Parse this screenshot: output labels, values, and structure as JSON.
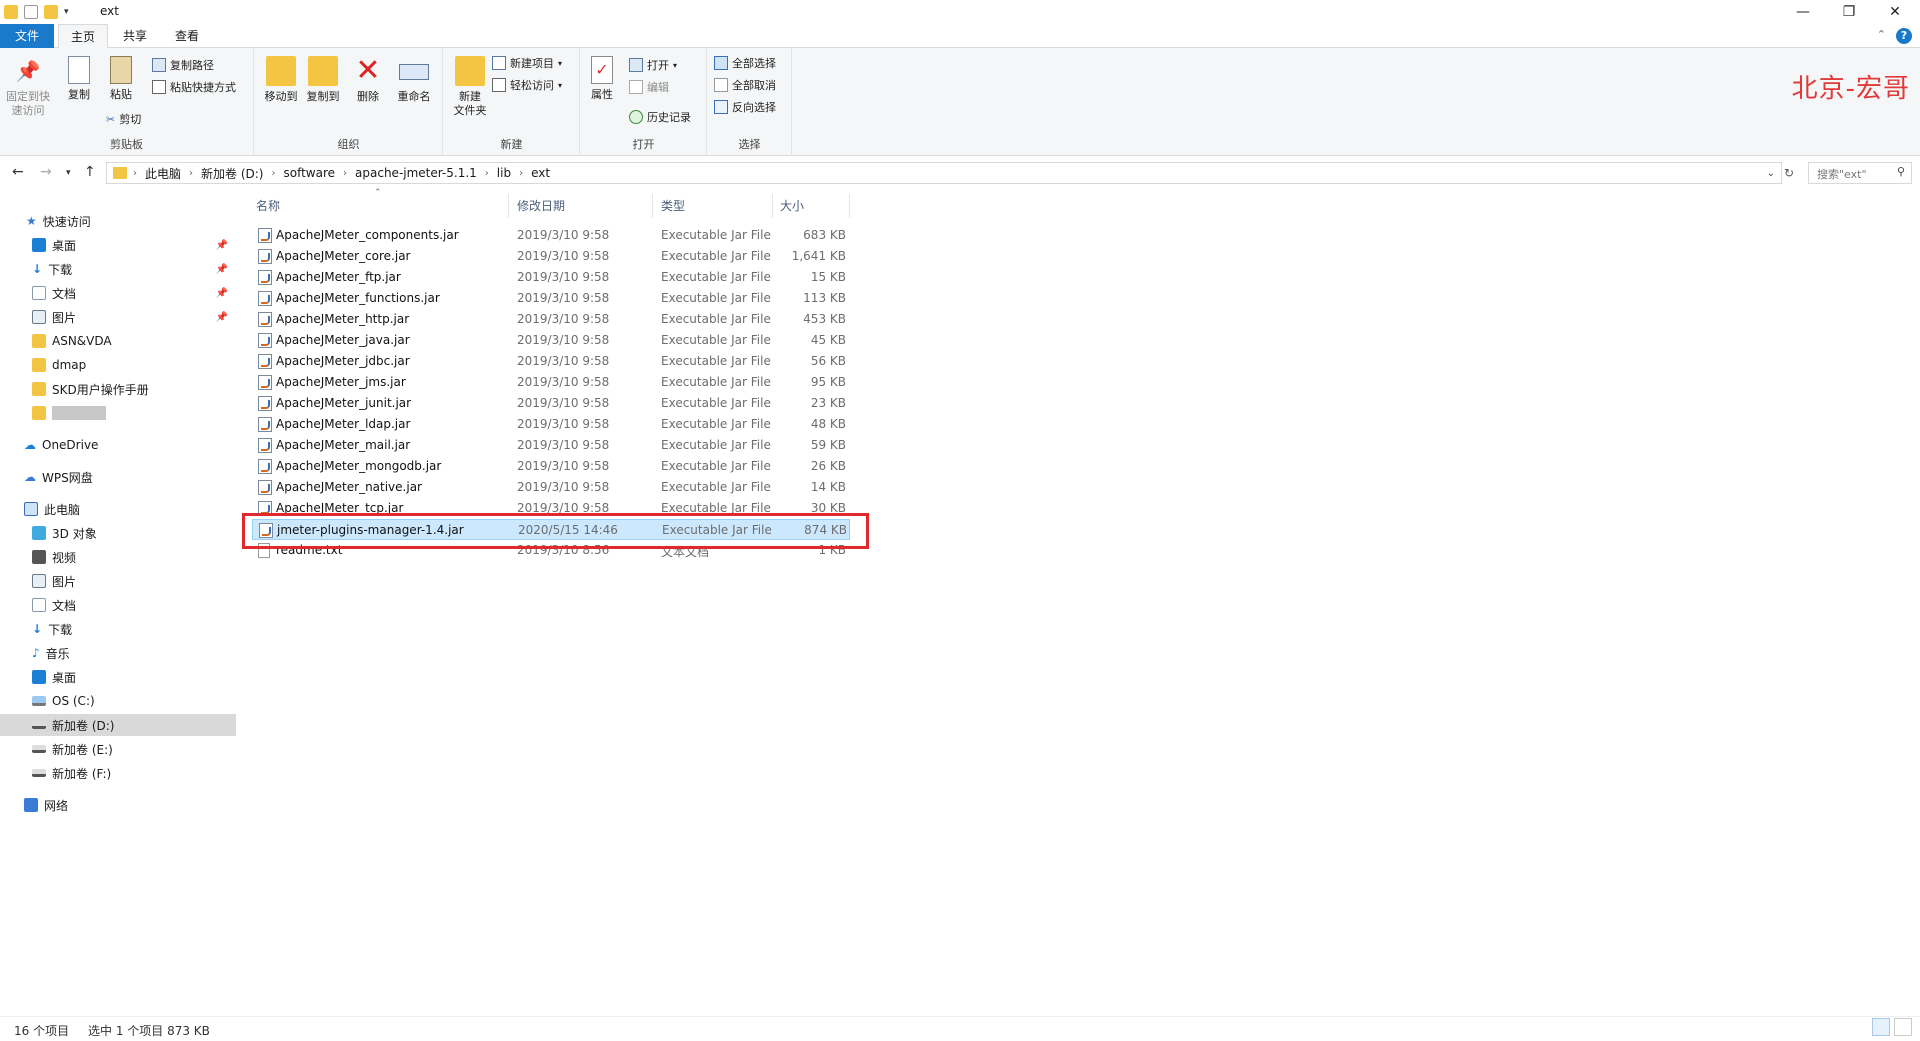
{
  "window": {
    "title": "ext",
    "controls": {
      "minimize": "—",
      "maximize": "❐",
      "close": "✕"
    }
  },
  "ribbon_tabs": [
    "文件",
    "主页",
    "共享",
    "查看"
  ],
  "ribbon": {
    "clipboard": {
      "label": "剪贴板",
      "pin": "固定到快\n速访问",
      "pin_line1": "固定到快",
      "pin_line2": "速访问",
      "copy": "复制",
      "paste": "粘贴",
      "copy_path": "复制路径",
      "paste_shortcut": "粘贴快捷方式",
      "cut": "剪切"
    },
    "organize": {
      "label": "组织",
      "move_to": "移动到",
      "copy_to": "复制到",
      "delete": "删除",
      "rename": "重命名"
    },
    "new": {
      "label": "新建",
      "new_folder_line1": "新建",
      "new_folder_line2": "文件夹",
      "new_item": "新建项目",
      "easy_access": "轻松访问"
    },
    "open": {
      "label": "打开",
      "properties": "属性",
      "open": "打开",
      "edit": "编辑",
      "history": "历史记录"
    },
    "select": {
      "label": "选择",
      "select_all": "全部选择",
      "select_none": "全部取消",
      "invert": "反向选择"
    },
    "watermark": "北京-宏哥"
  },
  "address": {
    "crumbs": [
      "此电脑",
      "新加卷 (D:)",
      "software",
      "apache-jmeter-5.1.1",
      "lib",
      "ext"
    ],
    "search_placeholder": "搜索\"ext\""
  },
  "sidebar": {
    "quick_access": "快速访问",
    "quick_items": [
      "桌面",
      "下载",
      "文档",
      "图片",
      "ASN&VDA",
      "dmap",
      "SKD用户操作手册"
    ],
    "onedrive": "OneDrive",
    "wps": "WPS网盘",
    "this_pc": "此电脑",
    "pc_items": [
      "3D 对象",
      "视频",
      "图片",
      "文档",
      "下载",
      "音乐",
      "桌面",
      "OS (C:)",
      "新加卷 (D:)",
      "新加卷 (E:)",
      "新加卷 (F:)"
    ],
    "network": "网络"
  },
  "columns": {
    "name": "名称",
    "date": "修改日期",
    "type": "类型",
    "size": "大小"
  },
  "files": [
    {
      "name": "ApacheJMeter_components.jar",
      "date": "2019/3/10 9:58",
      "type": "Executable Jar File",
      "size": "683 KB"
    },
    {
      "name": "ApacheJMeter_core.jar",
      "date": "2019/3/10 9:58",
      "type": "Executable Jar File",
      "size": "1,641 KB"
    },
    {
      "name": "ApacheJMeter_ftp.jar",
      "date": "2019/3/10 9:58",
      "type": "Executable Jar File",
      "size": "15 KB"
    },
    {
      "name": "ApacheJMeter_functions.jar",
      "date": "2019/3/10 9:58",
      "type": "Executable Jar File",
      "size": "113 KB"
    },
    {
      "name": "ApacheJMeter_http.jar",
      "date": "2019/3/10 9:58",
      "type": "Executable Jar File",
      "size": "453 KB"
    },
    {
      "name": "ApacheJMeter_java.jar",
      "date": "2019/3/10 9:58",
      "type": "Executable Jar File",
      "size": "45 KB"
    },
    {
      "name": "ApacheJMeter_jdbc.jar",
      "date": "2019/3/10 9:58",
      "type": "Executable Jar File",
      "size": "56 KB"
    },
    {
      "name": "ApacheJMeter_jms.jar",
      "date": "2019/3/10 9:58",
      "type": "Executable Jar File",
      "size": "95 KB"
    },
    {
      "name": "ApacheJMeter_junit.jar",
      "date": "2019/3/10 9:58",
      "type": "Executable Jar File",
      "size": "23 KB"
    },
    {
      "name": "ApacheJMeter_ldap.jar",
      "date": "2019/3/10 9:58",
      "type": "Executable Jar File",
      "size": "48 KB"
    },
    {
      "name": "ApacheJMeter_mail.jar",
      "date": "2019/3/10 9:58",
      "type": "Executable Jar File",
      "size": "59 KB"
    },
    {
      "name": "ApacheJMeter_mongodb.jar",
      "date": "2019/3/10 9:58",
      "type": "Executable Jar File",
      "size": "26 KB"
    },
    {
      "name": "ApacheJMeter_native.jar",
      "date": "2019/3/10 9:58",
      "type": "Executable Jar File",
      "size": "14 KB"
    },
    {
      "name": "ApacheJMeter_tcp.jar",
      "date": "2019/3/10 9:58",
      "type": "Executable Jar File",
      "size": "30 KB"
    },
    {
      "name": "jmeter-plugins-manager-1.4.jar",
      "date": "2020/5/15 14:46",
      "type": "Executable Jar File",
      "size": "874 KB"
    },
    {
      "name": "readme.txt",
      "date": "2019/3/10 8:56",
      "type": "文本文档",
      "size": "1 KB"
    }
  ],
  "status": {
    "count": "16 个项目",
    "selected": "选中 1 个项目  873 KB"
  },
  "colors": {
    "accent": "#1979ca",
    "selected_row": "#cce8ff",
    "highlight_box": "#e0282d"
  }
}
